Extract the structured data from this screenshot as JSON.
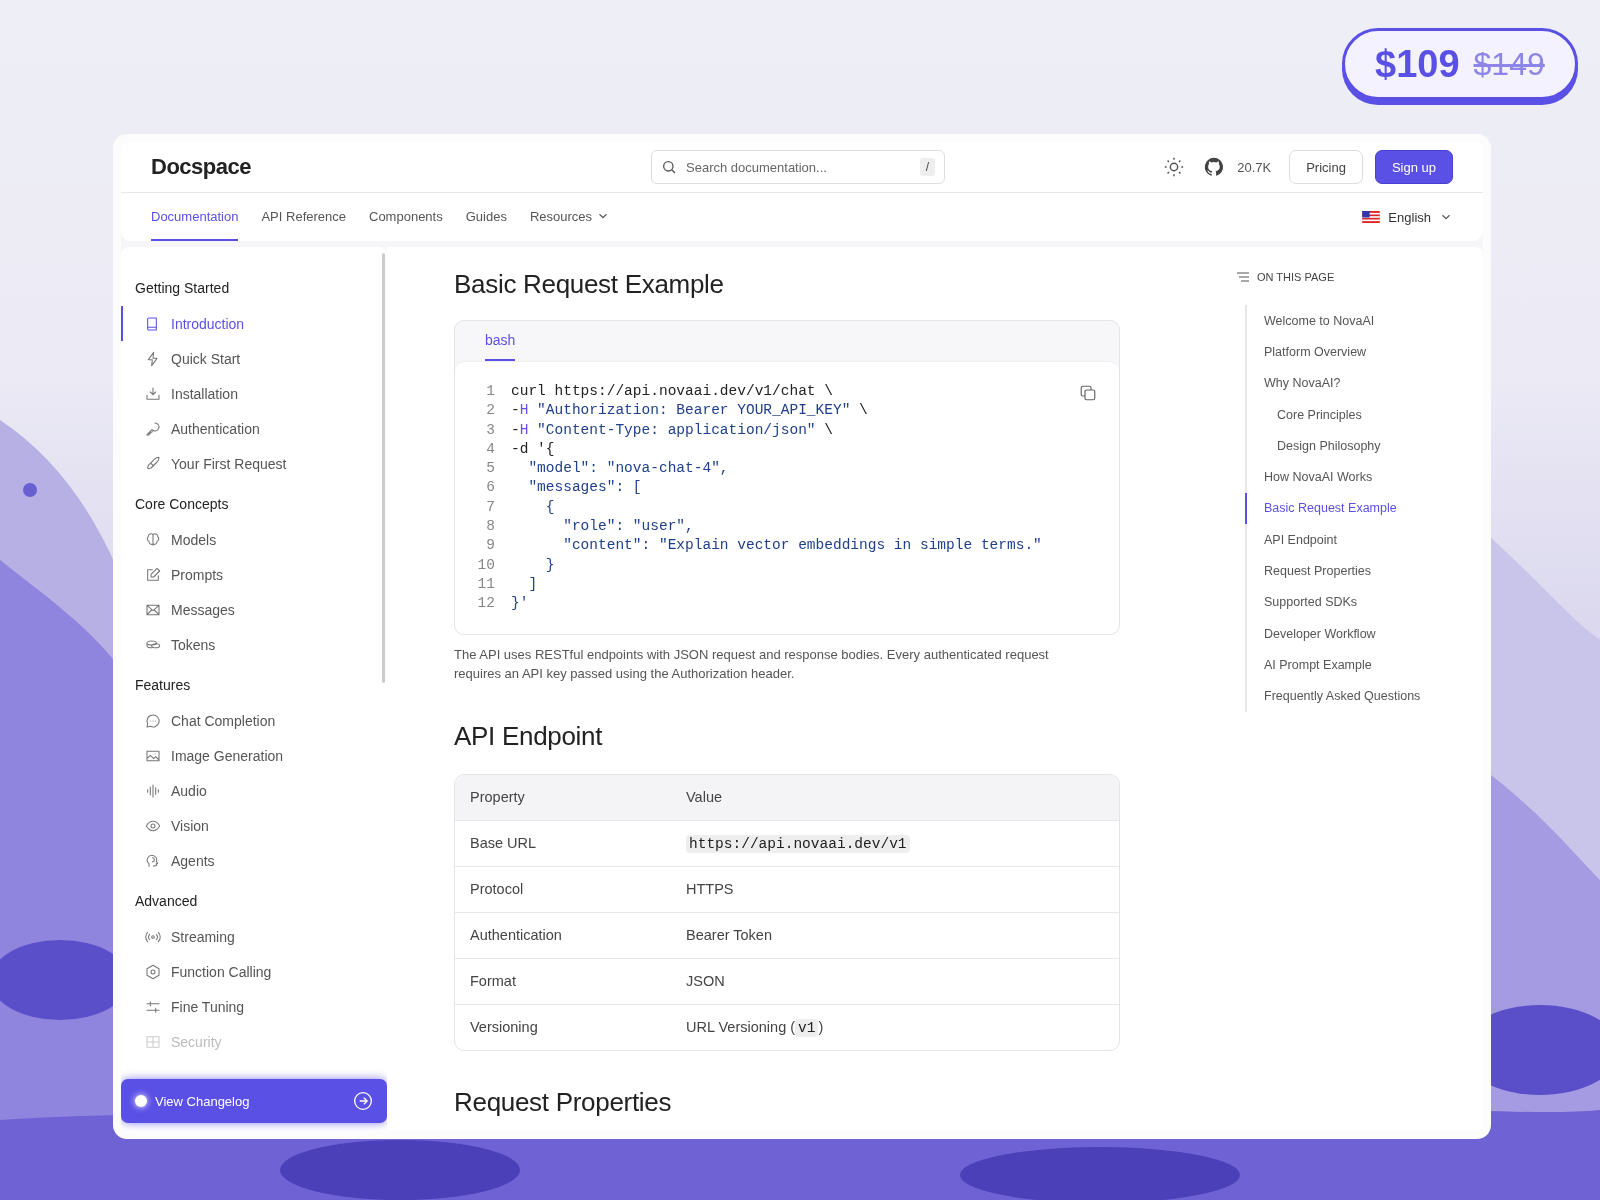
{
  "price_badge": {
    "price": "$109",
    "old_price": "$149"
  },
  "header": {
    "logo": "Docspace",
    "search": {
      "placeholder": "Search documentation...",
      "shortcut": "/"
    },
    "github_stars": "20.7K",
    "buttons": [
      {
        "label": "Pricing",
        "kind": "outline"
      },
      {
        "label": "Sign up",
        "kind": "primary"
      }
    ]
  },
  "nav": {
    "tabs": [
      {
        "label": "Documentation",
        "selected": true,
        "dropdown": false
      },
      {
        "label": "API Reference",
        "selected": false,
        "dropdown": false
      },
      {
        "label": "Components",
        "selected": false,
        "dropdown": false
      },
      {
        "label": "Guides",
        "selected": false,
        "dropdown": false
      },
      {
        "label": "Resources",
        "selected": false,
        "dropdown": true
      }
    ],
    "language": "English"
  },
  "sidebar": {
    "sections": [
      {
        "title": "Getting Started",
        "items": [
          {
            "label": "Introduction",
            "selected": true
          },
          {
            "label": "Quick Start",
            "selected": false
          },
          {
            "label": "Installation",
            "selected": false
          },
          {
            "label": "Authentication",
            "selected": false
          },
          {
            "label": "Your First Request",
            "selected": false
          }
        ]
      },
      {
        "title": "Core Concepts",
        "items": [
          {
            "label": "Models",
            "selected": false
          },
          {
            "label": "Prompts",
            "selected": false
          },
          {
            "label": "Messages",
            "selected": false
          },
          {
            "label": "Tokens",
            "selected": false
          }
        ]
      },
      {
        "title": "Features",
        "items": [
          {
            "label": "Chat Completion",
            "selected": false
          },
          {
            "label": "Image Generation",
            "selected": false
          },
          {
            "label": "Audio",
            "selected": false
          },
          {
            "label": "Vision",
            "selected": false
          },
          {
            "label": "Agents",
            "selected": false
          }
        ]
      },
      {
        "title": "Advanced",
        "items": [
          {
            "label": "Streaming",
            "selected": false
          },
          {
            "label": "Function Calling",
            "selected": false
          },
          {
            "label": "Fine Tuning",
            "selected": false
          },
          {
            "label": "Security",
            "selected": false,
            "faded": true
          }
        ]
      }
    ],
    "changelog_button": "View Changelog"
  },
  "content": {
    "title": "Basic Request Example",
    "code": {
      "tabs": [
        {
          "label": "bash",
          "selected": true
        }
      ],
      "lines": [
        {
          "number": "1",
          "segments": [
            {
              "text": "curl https://api.novaai.dev/v1/chat \\",
              "kind": "plain"
            }
          ]
        },
        {
          "number": "2",
          "segments": [
            {
              "text": "-",
              "kind": "plain"
            },
            {
              "text": "H",
              "kind": "flag"
            },
            {
              "text": " \"Authorization: Bearer YOUR_API_KEY\"",
              "kind": "string"
            },
            {
              "text": " \\",
              "kind": "plain"
            }
          ]
        },
        {
          "number": "3",
          "segments": [
            {
              "text": "-",
              "kind": "plain"
            },
            {
              "text": "H",
              "kind": "flag"
            },
            {
              "text": " \"Content-Type: application/json\"",
              "kind": "string"
            },
            {
              "text": " \\",
              "kind": "plain"
            }
          ]
        },
        {
          "number": "4",
          "segments": [
            {
              "text": "-d '{",
              "kind": "plain"
            }
          ]
        },
        {
          "number": "5",
          "segments": [
            {
              "text": "  \"model\": \"nova-chat-4\",",
              "kind": "string"
            }
          ]
        },
        {
          "number": "6",
          "segments": [
            {
              "text": "  \"messages\": [",
              "kind": "string"
            }
          ]
        },
        {
          "number": "7",
          "segments": [
            {
              "text": "    {",
              "kind": "string"
            }
          ]
        },
        {
          "number": "8",
          "segments": [
            {
              "text": "      \"role\": \"user\",",
              "kind": "string"
            }
          ]
        },
        {
          "number": "9",
          "segments": [
            {
              "text": "      \"content\": \"Explain vector embeddings in simple terms.\"",
              "kind": "string"
            }
          ]
        },
        {
          "number": "10",
          "segments": [
            {
              "text": "    }",
              "kind": "string"
            }
          ]
        },
        {
          "number": "11",
          "segments": [
            {
              "text": "  ]",
              "kind": "string"
            }
          ]
        },
        {
          "number": "12",
          "segments": [
            {
              "text": "}'",
              "kind": "string"
            }
          ]
        }
      ]
    },
    "description": "The API uses RESTful endpoints with JSON request and response bodies. Every authenticated request requires an API key passed using the Authorization header.",
    "endpoint_title": "API Endpoint",
    "table": {
      "columns": [
        "Property",
        "Value"
      ],
      "rows": [
        {
          "property": "Base URL",
          "value": [
            {
              "text": "https://api.novaai.dev/v1",
              "code": true
            }
          ]
        },
        {
          "property": "Protocol",
          "value": [
            {
              "text": "HTTPS",
              "code": false
            }
          ]
        },
        {
          "property": "Authentication",
          "value": [
            {
              "text": "Bearer Token",
              "code": false
            }
          ]
        },
        {
          "property": "Format",
          "value": [
            {
              "text": "JSON",
              "code": false
            }
          ]
        },
        {
          "property": "Versioning",
          "value": [
            {
              "text": "URL Versioning (",
              "code": false
            },
            {
              "text": "v1",
              "code": true
            },
            {
              "text": ")",
              "code": false
            }
          ]
        }
      ]
    },
    "next_title": "Request Properties"
  },
  "toc": {
    "title": "ON THIS PAGE",
    "items": [
      {
        "label": "Welcome to NovaAI",
        "selected": false
      },
      {
        "label": "Platform Overview",
        "selected": false
      },
      {
        "label": "Why NovaAI?",
        "selected": false,
        "children": [
          {
            "label": "Core Principles",
            "selected": false
          },
          {
            "label": "Design Philosophy",
            "selected": false
          }
        ]
      },
      {
        "label": "How NovaAI Works",
        "selected": false
      },
      {
        "label": "Basic Request Example",
        "selected": true
      },
      {
        "label": "API Endpoint",
        "selected": false
      },
      {
        "label": "Request Properties",
        "selected": false
      },
      {
        "label": "Supported SDKs",
        "selected": false
      },
      {
        "label": "Developer Workflow",
        "selected": false
      },
      {
        "label": "AI Prompt Example",
        "selected": false
      },
      {
        "label": "Frequently Asked Questions",
        "selected": false
      }
    ]
  }
}
